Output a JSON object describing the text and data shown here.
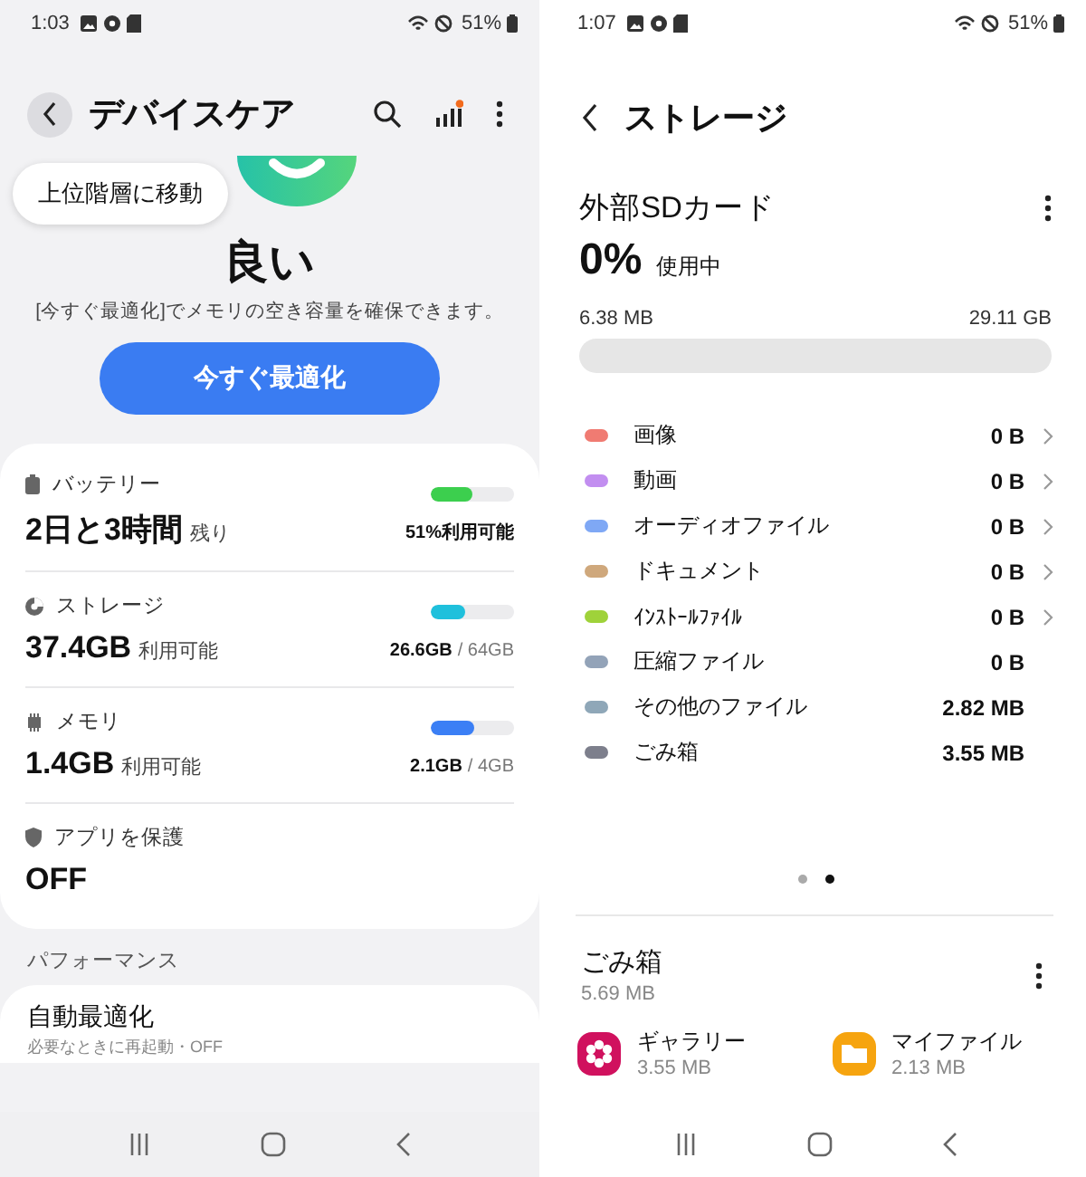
{
  "left_screen": {
    "status_bar": {
      "time": "1:03",
      "battery": "51%"
    },
    "header": {
      "title": "デバイスケア"
    },
    "tooltip": "上位階層に移動",
    "status_text": "良い",
    "hint": "[今すぐ最適化]でメモリの空き容量を確保できます。",
    "optimize_button": "今すぐ最適化",
    "items": [
      {
        "kind": "meter",
        "label": "バッテリー",
        "value": "2日と3時間",
        "unit": "残り",
        "level": 0.51,
        "color": "#3ccf4e",
        "reading": "51%利用可能"
      },
      {
        "kind": "meter",
        "label": "ストレージ",
        "value": "37.4GB",
        "unit": "利用可能",
        "level": 0.42,
        "color": "#1fc0dc",
        "reading": "26.6GB",
        "total": "/ 64GB"
      },
      {
        "kind": "meter",
        "label": "メモリ",
        "value": "1.4GB",
        "unit": "利用可能",
        "level": 0.53,
        "color": "#3b7ff5",
        "reading": "2.1GB",
        "total": "/ 4GB"
      },
      {
        "kind": "status",
        "label": "アプリを保護",
        "value": "OFF"
      }
    ],
    "section_title": "パフォーマンス",
    "auto_optimize": {
      "title": "自動最適化",
      "subtitle": "必要なときに再起動・OFF"
    }
  },
  "right_screen": {
    "status_bar": {
      "time": "1:07",
      "battery": "51%"
    },
    "header": {
      "title": "ストレージ"
    },
    "card": {
      "title": "外部SDカード",
      "percent": "0%",
      "percent_label": "使用中",
      "used": "6.38 MB",
      "total": "29.11 GB"
    },
    "categories": [
      {
        "name": "画像",
        "size": "0 B",
        "color": "#f07b72",
        "chevron": true
      },
      {
        "name": "動画",
        "size": "0 B",
        "color": "#c28ef0",
        "chevron": true
      },
      {
        "name": "オーディオファイル",
        "size": "0 B",
        "color": "#7fa8f5",
        "chevron": true
      },
      {
        "name": "ドキュメント",
        "size": "0 B",
        "color": "#cfa87c",
        "chevron": true
      },
      {
        "name": "ｲﾝｽﾄｰﾙﾌｧｲﾙ",
        "size": "0 B",
        "color": "#9fd23a",
        "chevron": true
      },
      {
        "name": "圧縮ファイル",
        "size": "0 B",
        "color": "#93a3b8",
        "chevron": false
      },
      {
        "name": "その他のファイル",
        "size": "2.82 MB",
        "color": "#8fa7b8",
        "chevron": false
      },
      {
        "name": "ごみ箱",
        "size": "3.55 MB",
        "color": "#7d7f8c",
        "chevron": false
      }
    ],
    "pages": [
      {
        "selected": false
      },
      {
        "selected": true
      }
    ],
    "trash": {
      "title": "ごみ箱",
      "size": "5.69 MB",
      "apps": [
        {
          "name": "ギャラリー",
          "size": "3.55 MB"
        },
        {
          "name": "マイファイル",
          "size": "2.13 MB"
        }
      ]
    }
  }
}
